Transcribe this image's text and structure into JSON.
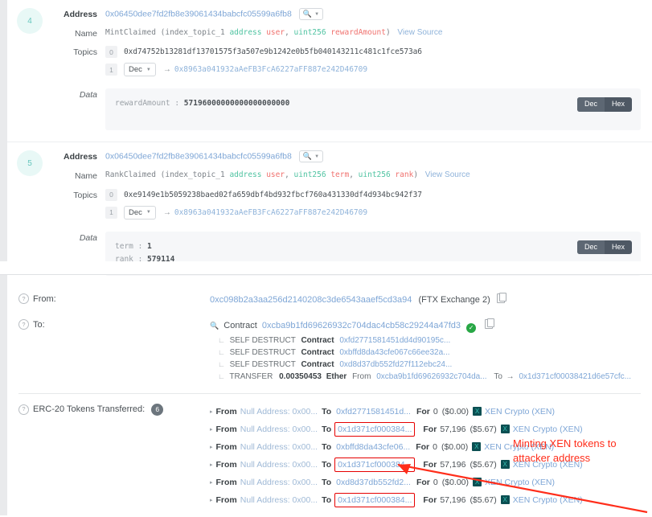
{
  "logs": [
    {
      "index": "4",
      "address_label": "Address",
      "address": "0x06450dee7fd2fb8e39061434babcfc05599a6fb8",
      "search_icon": "magnifier-icon",
      "name_label": "Name",
      "signature": {
        "fn": "MintClaimed (",
        "parts": [
          {
            "idx": "index_topic_1 ",
            "type": "address ",
            "arg": "user"
          },
          {
            "idx": ", ",
            "type": "uint256 ",
            "arg": "rewardAmount"
          }
        ],
        "close": ")",
        "view_source": "View Source"
      },
      "topics_label": "Topics",
      "topics": [
        {
          "num": "0",
          "hash": "0xd74752b13281df13701575f3a507e9b1242e0b5fb040143211c481c1fce573a6"
        },
        {
          "num": "1",
          "select": "Dec",
          "arrow": "→",
          "address": "0x8963a041932aAeFB3FcA6227aFF887e242D46709"
        }
      ],
      "data_label": "Data",
      "data_lines": [
        {
          "key": "rewardAmount : ",
          "value": "57196000000000000000000"
        }
      ],
      "dechex": {
        "dec": "Dec",
        "hex": "Hex",
        "active": "Dec"
      }
    },
    {
      "index": "5",
      "address_label": "Address",
      "address": "0x06450dee7fd2fb8e39061434babcfc05599a6fb8",
      "search_icon": "magnifier-icon",
      "name_label": "Name",
      "signature": {
        "fn": "RankClaimed (",
        "parts": [
          {
            "idx": "index_topic_1 ",
            "type": "address ",
            "arg": "user"
          },
          {
            "idx": ", ",
            "type": "uint256 ",
            "arg": "term"
          },
          {
            "idx": ", ",
            "type": "uint256 ",
            "arg": "rank"
          }
        ],
        "close": ")",
        "view_source": "View Source"
      },
      "topics_label": "Topics",
      "topics": [
        {
          "num": "0",
          "hash": "0xe9149e1b5059238baed02fa659dbf4bd932fbcf760a431330df4d934bc942f37"
        },
        {
          "num": "1",
          "select": "Dec",
          "arrow": "→",
          "address": "0x8963a041932aAeFB3FcA6227aFF887e242D46709"
        }
      ],
      "data_label": "Data",
      "data_lines": [
        {
          "key": "term : ",
          "value": "1"
        },
        {
          "key": "rank : ",
          "value": "579114"
        }
      ],
      "dechex": {
        "dec": "Dec",
        "hex": "Hex",
        "active": "Dec"
      }
    }
  ],
  "overview": {
    "from": {
      "label": "From:",
      "address": "0xc098b2a3aa256d2140208c3de6543aaef5cd3a94",
      "tag": "(FTX Exchange 2)",
      "copy_icon": "copy-icon"
    },
    "to": {
      "label": "To:",
      "contract_word": "Contract",
      "address": "0xcba9b1fd69626932c704dac4cb58c29244a47fd3",
      "verified_icon": "verified-check-icon",
      "copy_icon": "copy-icon",
      "magnifier_icon": "magnifier-icon",
      "internal": [
        {
          "action": "SELF DESTRUCT",
          "type": "Contract",
          "address": "0xfd2771581451dd4d90195c..."
        },
        {
          "action": "SELF DESTRUCT",
          "type": "Contract",
          "address": "0xbffd8da43cfe067c66ee32a..."
        },
        {
          "action": "SELF DESTRUCT",
          "type": "Contract",
          "address": "0xd8d37db552fd27f112ebc24..."
        },
        {
          "action": "TRANSFER",
          "amount": "0.00350453",
          "unit": "Ether",
          "from_word": "From",
          "from_address": "0xcba9b1fd69626932c704da...",
          "to_word": "To",
          "arrow": "→",
          "to_address": "0x1d371cf00038421d6e57cfc..."
        }
      ]
    },
    "erc20": {
      "label": "ERC-20 Tokens Transferred:",
      "count": "6",
      "rows": [
        {
          "from_kw": "From",
          "from": "Null Address: 0x00...",
          "to_kw": "To",
          "to": "0xfd2771581451d...",
          "boxed": false,
          "for_kw": "For",
          "amount": "0",
          "usd": "($0.00)",
          "token_icon": "xen-token-icon",
          "token": "XEN Crypto (XEN)"
        },
        {
          "from_kw": "From",
          "from": "Null Address: 0x00...",
          "to_kw": "To",
          "to": "0x1d371cf000384...",
          "boxed": true,
          "for_kw": "For",
          "amount": "57,196",
          "usd": "($5.67)",
          "token_icon": "xen-token-icon",
          "token": "XEN Crypto (XEN)"
        },
        {
          "from_kw": "From",
          "from": "Null Address: 0x00...",
          "to_kw": "To",
          "to": "0xbffd8da43cfe06...",
          "boxed": false,
          "for_kw": "For",
          "amount": "0",
          "usd": "($0.00)",
          "token_icon": "xen-token-icon",
          "token": "XEN Crypto (XEN)"
        },
        {
          "from_kw": "From",
          "from": "Null Address: 0x00...",
          "to_kw": "To",
          "to": "0x1d371cf000384...",
          "boxed": true,
          "for_kw": "For",
          "amount": "57,196",
          "usd": "($5.67)",
          "token_icon": "xen-token-icon",
          "token": "XEN Crypto (XEN)"
        },
        {
          "from_kw": "From",
          "from": "Null Address: 0x00...",
          "to_kw": "To",
          "to": "0xd8d37db552fd2...",
          "boxed": false,
          "for_kw": "For",
          "amount": "0",
          "usd": "($0.00)",
          "token_icon": "xen-token-icon",
          "token": "XEN Crypto (XEN)"
        },
        {
          "from_kw": "From",
          "from": "Null Address: 0x00...",
          "to_kw": "To",
          "to": "0x1d371cf000384...",
          "boxed": true,
          "for_kw": "For",
          "amount": "57,196",
          "usd": "($5.67)",
          "token_icon": "xen-token-icon",
          "token": "XEN Crypto (XEN)"
        }
      ]
    }
  },
  "annotation": {
    "text": "Minting XEN tokens to attacker address",
    "color": "#ff2d1a"
  },
  "colors": {
    "link": "#7ea6d6",
    "accent_teal": "#4fc3a1",
    "arg_red": "#f0726f",
    "highlight_box": "#e60000",
    "verified_green": "#28a745",
    "token_icon_bg": "#0b4f52"
  }
}
